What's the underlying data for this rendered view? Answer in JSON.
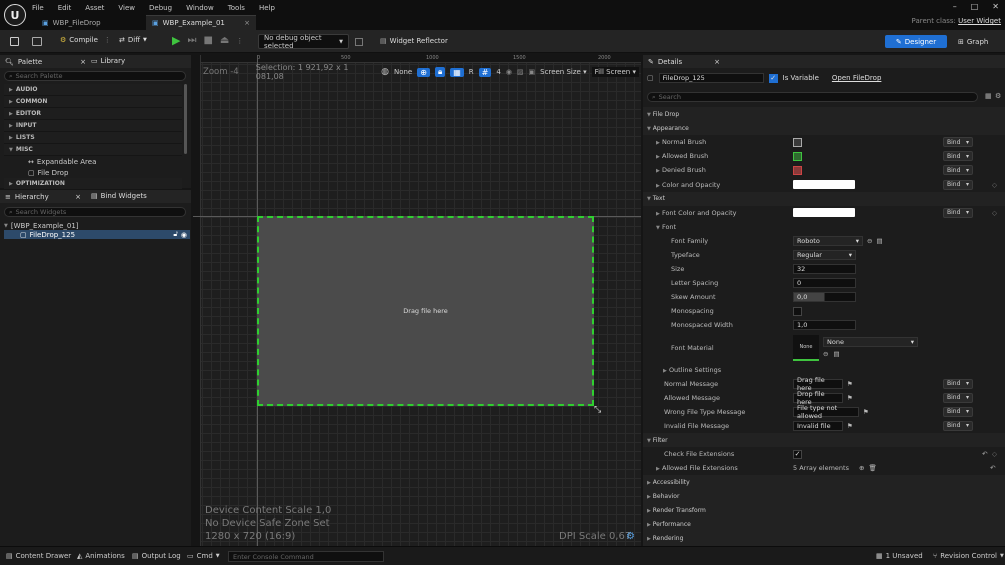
{
  "menu": [
    "File",
    "Edit",
    "Asset",
    "View",
    "Debug",
    "Window",
    "Tools",
    "Help"
  ],
  "tabs": [
    {
      "label": "WBP_FileDrop",
      "active": false
    },
    {
      "label": "WBP_Example_01",
      "active": true,
      "close": "×"
    }
  ],
  "window_controls": [
    "–",
    "□",
    "✕"
  ],
  "parent_class": {
    "label": "Parent class:",
    "value": "User Widget"
  },
  "toolbar": {
    "compile": "Compile",
    "diff": "Diff",
    "debug_select": "No debug object selected",
    "widget_reflector": "Widget Reflector",
    "designer": "Designer",
    "graph": "Graph"
  },
  "palette": {
    "tab": "Palette",
    "library": "Library",
    "search_placeholder": "Search Palette",
    "categories": [
      "AUDIO",
      "COMMON",
      "EDITOR",
      "INPUT",
      "LISTS",
      "MISC"
    ],
    "misc_items": [
      "Expandable Area",
      "File Drop"
    ],
    "last_category": "OPTIMIZATION"
  },
  "hierarchy": {
    "tab": "Hierarchy",
    "bind_widgets": "Bind Widgets",
    "search_placeholder": "Search Widgets",
    "root": "[WBP_Example_01]",
    "child": "FileDrop_125"
  },
  "viewport": {
    "zoom": "Zoom -4",
    "selection": "Selection: 1 921,92 x 1 081,08",
    "none_label": "None",
    "r_label": "R",
    "grid_value": "4",
    "screen_size": "Screen Size",
    "fill_screen": "Fill Screen",
    "ruler_marks": [
      "0",
      "500",
      "1000",
      "1500",
      "2000"
    ],
    "widget_text": "Drag file here",
    "overlay_lines": [
      "Device Content Scale 1,0",
      "No Device Safe Zone Set",
      "1280 x 720 (16:9)"
    ],
    "dpi": "DPI Scale 0,67"
  },
  "details": {
    "tab": "Details",
    "name": "FileDrop_125",
    "is_variable": "Is Variable",
    "open_link": "Open FileDrop",
    "search_placeholder": "Search",
    "sections": {
      "file_drop": "File Drop",
      "appearance": "Appearance",
      "text": "Text",
      "font": "Font",
      "filter": "Filter",
      "accessibility": "Accessibility",
      "behavior": "Behavior",
      "render_transform": "Render Transform",
      "performance": "Performance",
      "rendering": "Rendering"
    },
    "bind": "Bind",
    "appearance": [
      "Normal Brush",
      "Allowed Brush",
      "Denied Brush",
      "Color and Opacity"
    ],
    "brush_colors": [
      "#3a3a3a",
      "#2f6a2f",
      "#8a3a3a"
    ],
    "text": {
      "font_color": "Font Color and Opacity"
    },
    "font": {
      "family_label": "Font Family",
      "family": "Roboto",
      "typeface_label": "Typeface",
      "typeface": "Regular",
      "size_label": "Size",
      "size": "32",
      "letter_spacing_label": "Letter Spacing",
      "letter_spacing": "0",
      "skew_label": "Skew Amount",
      "skew": "0,0",
      "mono_label": "Monospacing",
      "mono_width_label": "Monospaced Width",
      "mono_width": "1,0",
      "material_label": "Font Material",
      "material": "None",
      "material_thumb": "None",
      "outline": "Outline Settings"
    },
    "messages": [
      {
        "label": "Normal Message",
        "value": "Drag file here"
      },
      {
        "label": "Allowed Message",
        "value": "Drop file here"
      },
      {
        "label": "Wrong File Type Message",
        "value": "File type not allowed"
      },
      {
        "label": "Invalid File Message",
        "value": "Invalid file"
      }
    ],
    "filter": {
      "check_label": "Check File Extensions",
      "allowed_label": "Allowed File Extensions",
      "allowed_value": "5 Array elements"
    }
  },
  "bottom": {
    "content_drawer": "Content Drawer",
    "animations": "Animations",
    "output_log": "Output Log",
    "cmd": "Cmd",
    "console_placeholder": "Enter Console Command",
    "unsaved": "1 Unsaved",
    "revision": "Revision Control"
  }
}
